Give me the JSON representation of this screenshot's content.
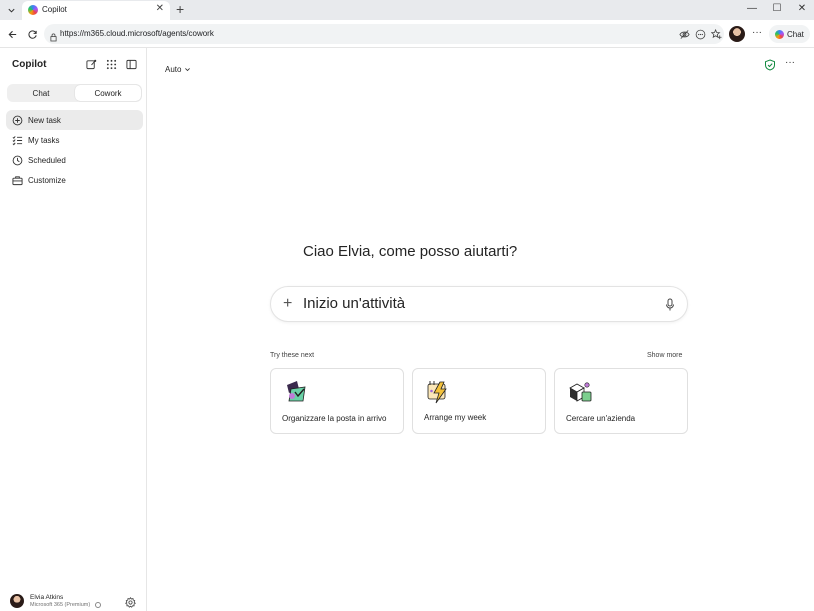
{
  "browser": {
    "tab_title": "Copilot",
    "tab_close": "✕",
    "new_tab": "+",
    "url": "https://m365.cloud.microsoft/agents/cowork",
    "chat_button_label": "Chat",
    "more": "···",
    "window_controls": {
      "minimize": "—",
      "maximize": "☐",
      "close": "✕"
    }
  },
  "sidebar": {
    "brand": "Copilot",
    "modes": [
      {
        "label": "Chat",
        "active": false
      },
      {
        "label": "Cowork",
        "active": true
      }
    ],
    "items": [
      {
        "label": "New task",
        "icon": "plus-circle-icon",
        "selected": true
      },
      {
        "label": "My tasks",
        "icon": "checklist-icon",
        "selected": false
      },
      {
        "label": "Scheduled",
        "icon": "clock-icon",
        "selected": false
      },
      {
        "label": "Customize",
        "icon": "briefcase-icon",
        "selected": false
      }
    ],
    "user": {
      "name": "Elvia Atkins",
      "plan": "Microsoft 365 (Premium)"
    }
  },
  "main": {
    "model_selector": "Auto",
    "more": "···",
    "greeting": "Ciao Elvia, come posso aiutarti?",
    "composer_placeholder": "Inizio un'attività",
    "composer_add": "+",
    "suggestions_title": "Try these next",
    "show_more": "Show more",
    "cards": [
      {
        "label": "Organizzare la posta in arrivo",
        "icon": "mail-organize-icon"
      },
      {
        "label": "Arrange my week",
        "icon": "lightning-calendar-icon"
      },
      {
        "label": "Cercare un'azienda",
        "icon": "building-search-icon"
      }
    ]
  },
  "colors": {
    "accent_green": "#10893e",
    "selected_bg": "#ebebeb",
    "border": "#e0e0e0"
  }
}
